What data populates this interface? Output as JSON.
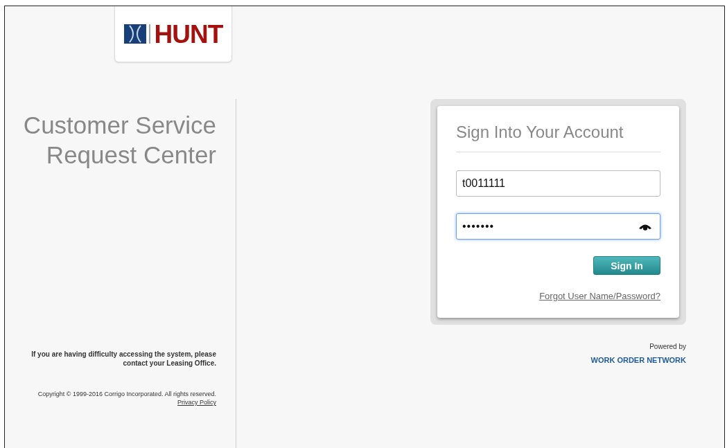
{
  "logo": {
    "text": "HUNT"
  },
  "heading": {
    "line1": "Customer Service",
    "line2": "Request Center"
  },
  "help_text": "If you are having difficulty accessing the system, please contact your Leasing Office.",
  "copyright": "Copyright © 1999-2016 Corrigo Incorporated. All rights reserved.",
  "privacy_link": "Privacy Policy",
  "login": {
    "title": "Sign Into Your Account",
    "fields": [
      {
        "kind": "text",
        "value": "t0011111",
        "focused": false
      },
      {
        "kind": "password",
        "value": "•••••••",
        "focused": true
      }
    ],
    "button": "Sign In",
    "forgot_link": "Forgot User Name/Password?"
  },
  "powered_by": "Powered by",
  "network_link": "WORK ORDER NETWORK"
}
